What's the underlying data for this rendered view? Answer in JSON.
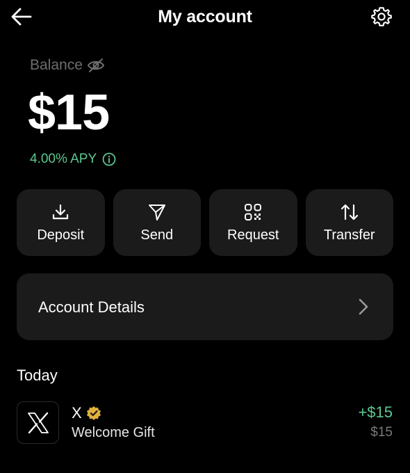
{
  "header": {
    "title": "My account",
    "back_icon": "arrow-left-icon",
    "settings_icon": "gear-icon"
  },
  "balance": {
    "label": "Balance",
    "visibility_icon": "eye-off-icon",
    "amount": "$15",
    "apy": "4.00% APY",
    "apy_icon": "info-icon"
  },
  "actions": [
    {
      "label": "Deposit",
      "icon": "download-icon"
    },
    {
      "label": "Send",
      "icon": "send-icon"
    },
    {
      "label": "Request",
      "icon": "qr-code-icon"
    },
    {
      "label": "Transfer",
      "icon": "transfer-arrows-icon"
    }
  ],
  "account_details": {
    "label": "Account Details",
    "icon": "chevron-right-icon"
  },
  "transactions": {
    "section_title": "Today",
    "items": [
      {
        "name": "X",
        "description": "Welcome Gift",
        "amount": "+$15",
        "balance_after": "$15",
        "logo_icon": "x-logo-icon",
        "badge_icon": "verified-badge-icon"
      }
    ]
  },
  "colors": {
    "background": "#000000",
    "card": "#1b1b1b",
    "positive": "#5cc890",
    "muted": "#6e6e6e",
    "badge": "#e2b13c"
  }
}
